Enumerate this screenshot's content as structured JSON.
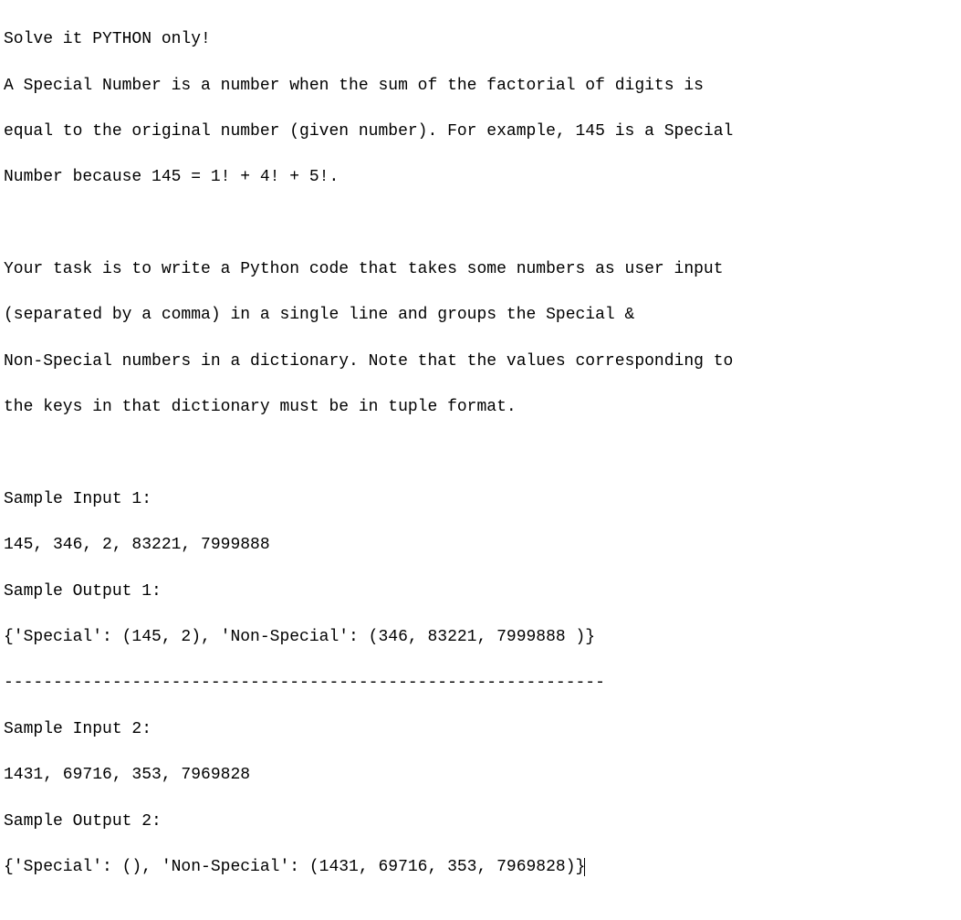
{
  "lines": {
    "l0": "Solve it PYTHON only!",
    "l1": "A Special Number is a number when the sum of the factorial of digits is",
    "l2": "equal to the original number (given number). For example, 145 is a Special",
    "l3": "Number because 145 = 1! + 4! + 5!.",
    "l4": "",
    "l5": "Your task is to write a Python code that takes some numbers as user input",
    "l6": "(separated by a comma) in a single line and groups the Special &",
    "l7": "Non-Special numbers in a dictionary. Note that the values corresponding to",
    "l8": "the keys in that dictionary must be in tuple format.",
    "l9": "",
    "l10": "Sample Input 1:",
    "l11": "145, 346, 2, 83221, 7999888",
    "l12": "Sample Output 1:",
    "l13": "{'Special': (145, 2), 'Non-Special': (346, 83221, 7999888 )}",
    "l14": "-------------------------------------------------------------",
    "l15": "Sample Input 2:",
    "l16": "1431, 69716, 353, 7969828",
    "l17": "Sample Output 2:",
    "l18": "{'Special': (), 'Non-Special': (1431, 69716, 353, 7969828)}"
  }
}
